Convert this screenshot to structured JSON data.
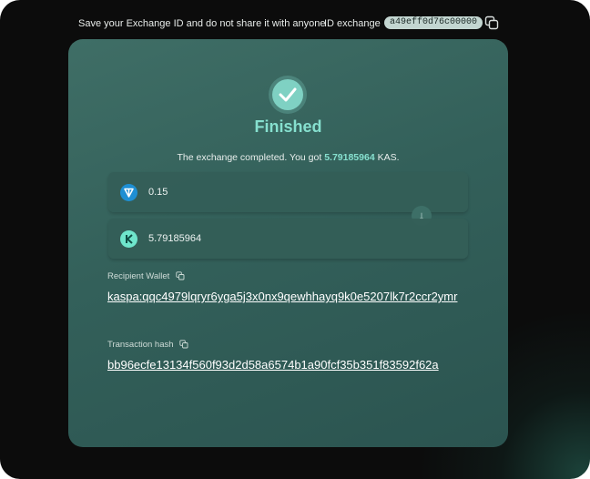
{
  "header": {
    "message": "Save your Exchange ID and do not share it with anyone",
    "id_label": "ID exchange",
    "id_value": "a49eff0d76c00000"
  },
  "status": {
    "title": "Finished",
    "summary_prefix": "The exchange completed. You got ",
    "summary_amount": "5.79185964",
    "summary_suffix": " KAS."
  },
  "send": {
    "amount": "0.15",
    "coin_icon": "ton-icon"
  },
  "receive": {
    "amount": "5.79185964",
    "coin_icon": "kaspa-icon"
  },
  "recipient": {
    "label": "Recipient Wallet",
    "address": "kaspa:qqc4979lqryr6yga5j3x0nx9qewhhayq9k0e5207lk7r2ccr2ymr"
  },
  "transaction": {
    "label": "Transaction hash",
    "hash": "bb96ecfe13134f560f93d2d58a6574b1a90fcf35b351f83592f62a"
  },
  "colors": {
    "accent": "#86e0cf",
    "card": "#3a6a63",
    "background": "#0c0c0c"
  }
}
